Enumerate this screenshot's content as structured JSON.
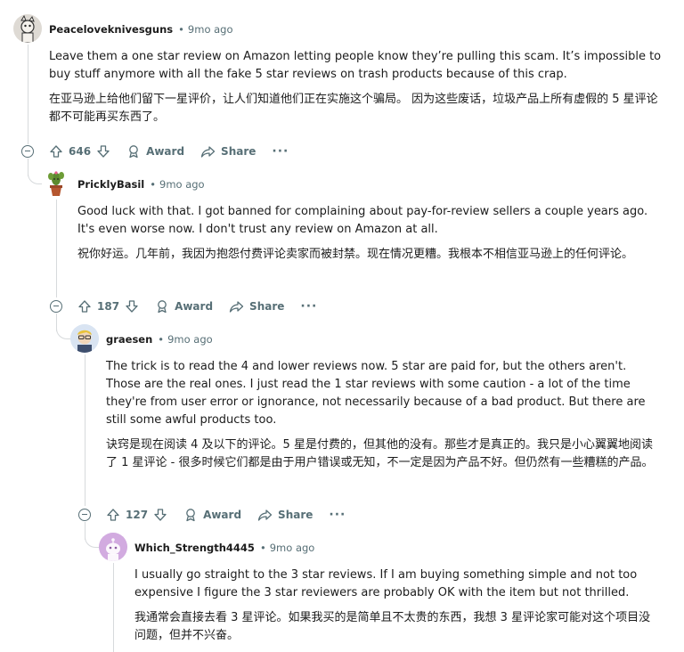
{
  "comments": [
    {
      "username": "Peaceloveknivesguns",
      "time": "9mo ago",
      "body_en": "Leave them a one star review on Amazon letting people know they’re pulling this scam. It’s impossible to buy stuff anymore with all the fake 5 star reviews on trash products because of this crap.",
      "body_zh": "在亚马逊上给他们留下一星评价，让人们知道他们正在实施这个骗局。 因为这些废话，垃圾产品上所有虚假的 5 星评论都不可能再买东西了。",
      "votes": "646",
      "award": "Award",
      "share": "Share"
    },
    {
      "username": "PricklyBasil",
      "time": "9mo ago",
      "body_en": "Good luck with that. I got banned for complaining about pay-for-review sellers a couple years ago. It's even worse now. I don't trust any review on Amazon at all.",
      "body_zh": "祝你好运。几年前，我因为抱怨付费评论卖家而被封禁。现在情况更糟。我根本不相信亚马逊上的任何评论。",
      "votes": "187",
      "award": "Award",
      "share": "Share"
    },
    {
      "username": "graesen",
      "time": "9mo ago",
      "body_en": "The trick is to read the 4 and lower reviews now. 5 star are paid for, but the others aren't. Those are the real ones. I just read the 1 star reviews with some caution - a lot of the time they're from user error or ignorance, not necessarily because of a bad product. But there are still some awful products too.",
      "body_zh": "诀窍是现在阅读 4 及以下的评论。5 星是付费的，但其他的没有。那些才是真正的。我只是小心翼翼地阅读了 1 星评论 - 很多时候它们都是由于用户错误或无知，不一定是因为产品不好。但仍然有一些糟糕的产品。",
      "votes": "127",
      "award": "Award",
      "share": "Share"
    },
    {
      "username": "Which_Strength4445",
      "time": "9mo ago",
      "body_en": "I usually go straight to the 3 star reviews. If I am buying something simple and not too expensive I figure the 3 star reviewers are probably OK with the item but not thrilled.",
      "body_zh": "我通常会直接去看 3 星评论。如果我买的是简单且不太贵的东西，我想 3 星评论家可能对这个项目没问题，但并不兴奋。"
    }
  ],
  "separator": "•",
  "more": "···"
}
